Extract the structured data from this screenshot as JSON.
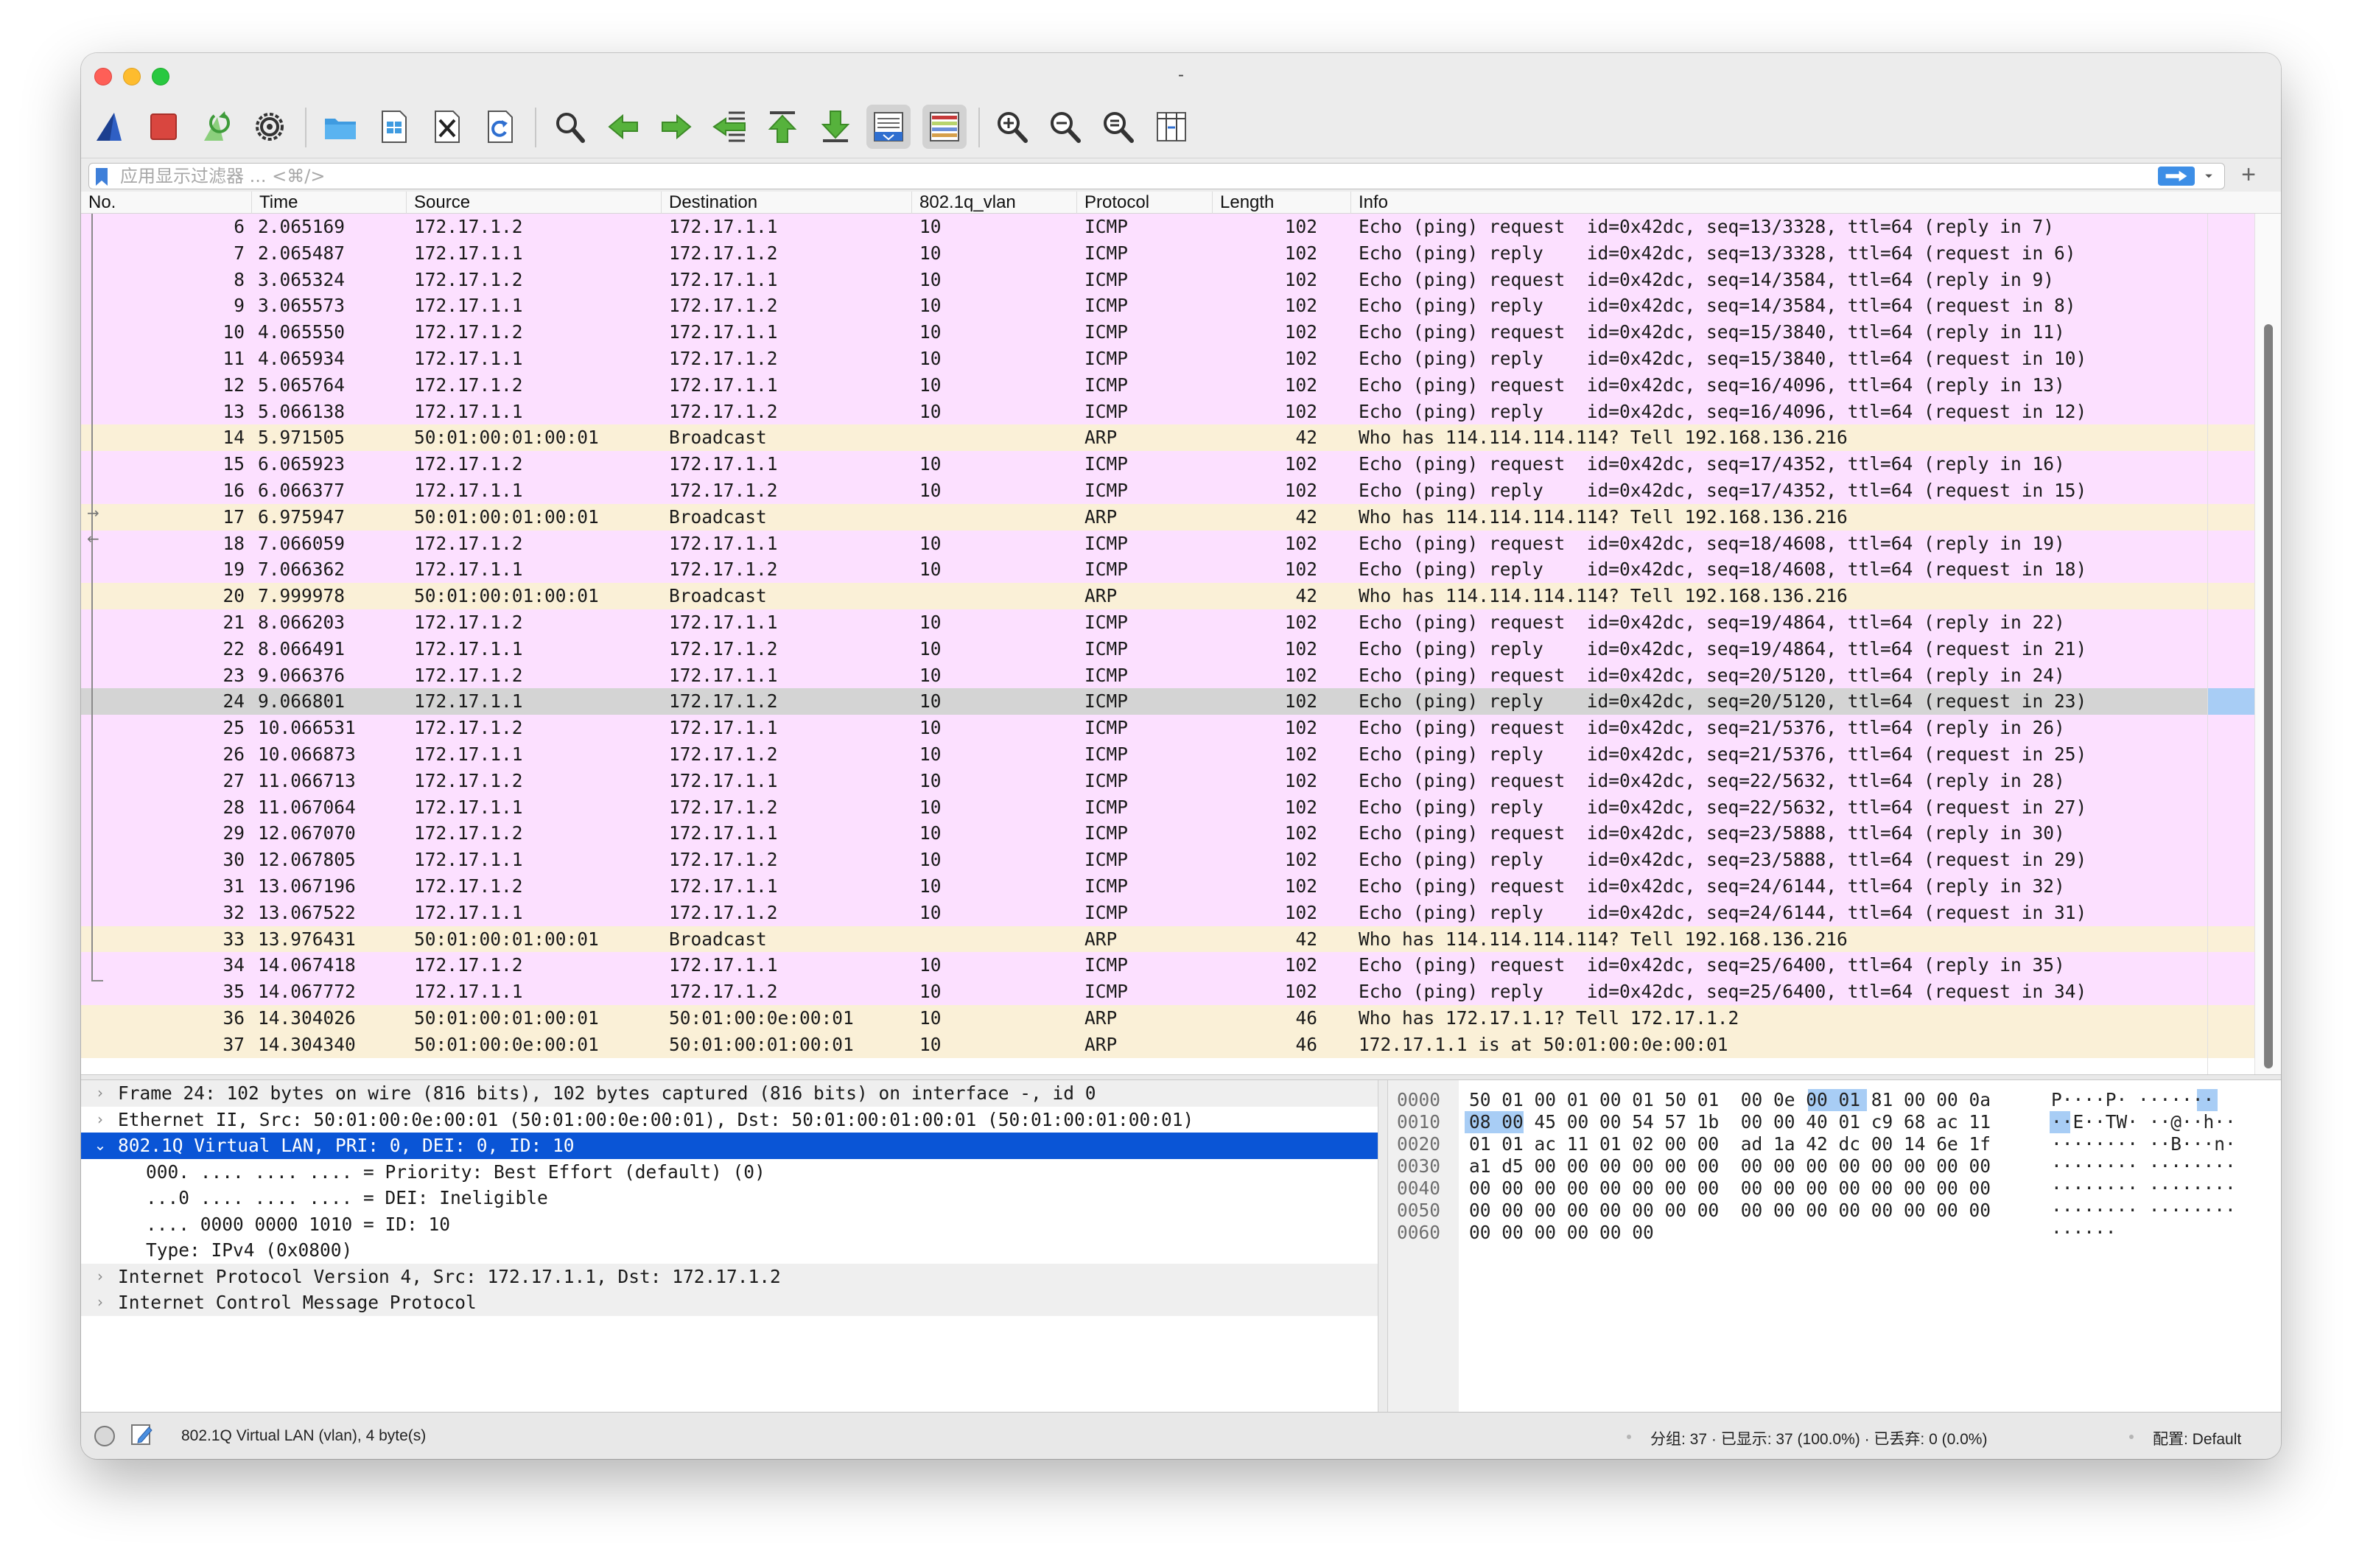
{
  "window": {
    "title": "-"
  },
  "filter": {
    "placeholder": "应用显示过滤器 ... <⌘/>"
  },
  "columns": {
    "no": "No.",
    "time": "Time",
    "source": "Source",
    "destination": "Destination",
    "vlan": "802.1q_vlan",
    "protocol": "Protocol",
    "length": "Length",
    "info": "Info"
  },
  "toolbar": {
    "buttons": [
      "shark-fin-start-icon",
      "stop-capture-icon",
      "restart-capture-icon",
      "capture-options-icon",
      "open-file-icon",
      "save-file-icon",
      "close-file-icon",
      "reload-file-icon",
      "find-packet-icon",
      "go-back-icon",
      "go-forward-icon",
      "go-to-packet-icon",
      "go-first-icon",
      "go-last-icon",
      "autoscroll-icon",
      "colorize-icon",
      "zoom-in-icon",
      "zoom-out-icon",
      "zoom-reset-icon",
      "resize-columns-icon"
    ]
  },
  "packets": [
    {
      "no": "6",
      "time": "2.065169",
      "src": "172.17.1.2",
      "dst": "172.17.1.1",
      "vlan": "10",
      "proto": "ICMP",
      "len": "102",
      "info": "Echo (ping) request  id=0x42dc, seq=13/3328, ttl=64 (reply in 7)"
    },
    {
      "no": "7",
      "time": "2.065487",
      "src": "172.17.1.1",
      "dst": "172.17.1.2",
      "vlan": "10",
      "proto": "ICMP",
      "len": "102",
      "info": "Echo (ping) reply    id=0x42dc, seq=13/3328, ttl=64 (request in 6)"
    },
    {
      "no": "8",
      "time": "3.065324",
      "src": "172.17.1.2",
      "dst": "172.17.1.1",
      "vlan": "10",
      "proto": "ICMP",
      "len": "102",
      "info": "Echo (ping) request  id=0x42dc, seq=14/3584, ttl=64 (reply in 9)"
    },
    {
      "no": "9",
      "time": "3.065573",
      "src": "172.17.1.1",
      "dst": "172.17.1.2",
      "vlan": "10",
      "proto": "ICMP",
      "len": "102",
      "info": "Echo (ping) reply    id=0x42dc, seq=14/3584, ttl=64 (request in 8)"
    },
    {
      "no": "10",
      "time": "4.065550",
      "src": "172.17.1.2",
      "dst": "172.17.1.1",
      "vlan": "10",
      "proto": "ICMP",
      "len": "102",
      "info": "Echo (ping) request  id=0x42dc, seq=15/3840, ttl=64 (reply in 11)"
    },
    {
      "no": "11",
      "time": "4.065934",
      "src": "172.17.1.1",
      "dst": "172.17.1.2",
      "vlan": "10",
      "proto": "ICMP",
      "len": "102",
      "info": "Echo (ping) reply    id=0x42dc, seq=15/3840, ttl=64 (request in 10)"
    },
    {
      "no": "12",
      "time": "5.065764",
      "src": "172.17.1.2",
      "dst": "172.17.1.1",
      "vlan": "10",
      "proto": "ICMP",
      "len": "102",
      "info": "Echo (ping) request  id=0x42dc, seq=16/4096, ttl=64 (reply in 13)"
    },
    {
      "no": "13",
      "time": "5.066138",
      "src": "172.17.1.1",
      "dst": "172.17.1.2",
      "vlan": "10",
      "proto": "ICMP",
      "len": "102",
      "info": "Echo (ping) reply    id=0x42dc, seq=16/4096, ttl=64 (request in 12)"
    },
    {
      "no": "14",
      "time": "5.971505",
      "src": "50:01:00:01:00:01",
      "dst": "Broadcast",
      "vlan": "",
      "proto": "ARP",
      "len": "42",
      "info": "Who has 114.114.114.114? Tell 192.168.136.216"
    },
    {
      "no": "15",
      "time": "6.065923",
      "src": "172.17.1.2",
      "dst": "172.17.1.1",
      "vlan": "10",
      "proto": "ICMP",
      "len": "102",
      "info": "Echo (ping) request  id=0x42dc, seq=17/4352, ttl=64 (reply in 16)"
    },
    {
      "no": "16",
      "time": "6.066377",
      "src": "172.17.1.1",
      "dst": "172.17.1.2",
      "vlan": "10",
      "proto": "ICMP",
      "len": "102",
      "info": "Echo (ping) reply    id=0x42dc, seq=17/4352, ttl=64 (request in 15)"
    },
    {
      "no": "17",
      "time": "6.975947",
      "src": "50:01:00:01:00:01",
      "dst": "Broadcast",
      "vlan": "",
      "proto": "ARP",
      "len": "42",
      "info": "Who has 114.114.114.114? Tell 192.168.136.216"
    },
    {
      "no": "18",
      "time": "7.066059",
      "src": "172.17.1.2",
      "dst": "172.17.1.1",
      "vlan": "10",
      "proto": "ICMP",
      "len": "102",
      "info": "Echo (ping) request  id=0x42dc, seq=18/4608, ttl=64 (reply in 19)"
    },
    {
      "no": "19",
      "time": "7.066362",
      "src": "172.17.1.1",
      "dst": "172.17.1.2",
      "vlan": "10",
      "proto": "ICMP",
      "len": "102",
      "info": "Echo (ping) reply    id=0x42dc, seq=18/4608, ttl=64 (request in 18)"
    },
    {
      "no": "20",
      "time": "7.999978",
      "src": "50:01:00:01:00:01",
      "dst": "Broadcast",
      "vlan": "",
      "proto": "ARP",
      "len": "42",
      "info": "Who has 114.114.114.114? Tell 192.168.136.216"
    },
    {
      "no": "21",
      "time": "8.066203",
      "src": "172.17.1.2",
      "dst": "172.17.1.1",
      "vlan": "10",
      "proto": "ICMP",
      "len": "102",
      "info": "Echo (ping) request  id=0x42dc, seq=19/4864, ttl=64 (reply in 22)"
    },
    {
      "no": "22",
      "time": "8.066491",
      "src": "172.17.1.1",
      "dst": "172.17.1.2",
      "vlan": "10",
      "proto": "ICMP",
      "len": "102",
      "info": "Echo (ping) reply    id=0x42dc, seq=19/4864, ttl=64 (request in 21)"
    },
    {
      "no": "23",
      "time": "9.066376",
      "src": "172.17.1.2",
      "dst": "172.17.1.1",
      "vlan": "10",
      "proto": "ICMP",
      "len": "102",
      "info": "Echo (ping) request  id=0x42dc, seq=20/5120, ttl=64 (reply in 24)"
    },
    {
      "no": "24",
      "time": "9.066801",
      "src": "172.17.1.1",
      "dst": "172.17.1.2",
      "vlan": "10",
      "proto": "ICMP",
      "len": "102",
      "info": "Echo (ping) reply    id=0x42dc, seq=20/5120, ttl=64 (request in 23)",
      "selected": true
    },
    {
      "no": "25",
      "time": "10.066531",
      "src": "172.17.1.2",
      "dst": "172.17.1.1",
      "vlan": "10",
      "proto": "ICMP",
      "len": "102",
      "info": "Echo (ping) request  id=0x42dc, seq=21/5376, ttl=64 (reply in 26)"
    },
    {
      "no": "26",
      "time": "10.066873",
      "src": "172.17.1.1",
      "dst": "172.17.1.2",
      "vlan": "10",
      "proto": "ICMP",
      "len": "102",
      "info": "Echo (ping) reply    id=0x42dc, seq=21/5376, ttl=64 (request in 25)"
    },
    {
      "no": "27",
      "time": "11.066713",
      "src": "172.17.1.2",
      "dst": "172.17.1.1",
      "vlan": "10",
      "proto": "ICMP",
      "len": "102",
      "info": "Echo (ping) request  id=0x42dc, seq=22/5632, ttl=64 (reply in 28)"
    },
    {
      "no": "28",
      "time": "11.067064",
      "src": "172.17.1.1",
      "dst": "172.17.1.2",
      "vlan": "10",
      "proto": "ICMP",
      "len": "102",
      "info": "Echo (ping) reply    id=0x42dc, seq=22/5632, ttl=64 (request in 27)"
    },
    {
      "no": "29",
      "time": "12.067070",
      "src": "172.17.1.2",
      "dst": "172.17.1.1",
      "vlan": "10",
      "proto": "ICMP",
      "len": "102",
      "info": "Echo (ping) request  id=0x42dc, seq=23/5888, ttl=64 (reply in 30)"
    },
    {
      "no": "30",
      "time": "12.067805",
      "src": "172.17.1.1",
      "dst": "172.17.1.2",
      "vlan": "10",
      "proto": "ICMP",
      "len": "102",
      "info": "Echo (ping) reply    id=0x42dc, seq=23/5888, ttl=64 (request in 29)"
    },
    {
      "no": "31",
      "time": "13.067196",
      "src": "172.17.1.2",
      "dst": "172.17.1.1",
      "vlan": "10",
      "proto": "ICMP",
      "len": "102",
      "info": "Echo (ping) request  id=0x42dc, seq=24/6144, ttl=64 (reply in 32)"
    },
    {
      "no": "32",
      "time": "13.067522",
      "src": "172.17.1.1",
      "dst": "172.17.1.2",
      "vlan": "10",
      "proto": "ICMP",
      "len": "102",
      "info": "Echo (ping) reply    id=0x42dc, seq=24/6144, ttl=64 (request in 31)"
    },
    {
      "no": "33",
      "time": "13.976431",
      "src": "50:01:00:01:00:01",
      "dst": "Broadcast",
      "vlan": "",
      "proto": "ARP",
      "len": "42",
      "info": "Who has 114.114.114.114? Tell 192.168.136.216"
    },
    {
      "no": "34",
      "time": "14.067418",
      "src": "172.17.1.2",
      "dst": "172.17.1.1",
      "vlan": "10",
      "proto": "ICMP",
      "len": "102",
      "info": "Echo (ping) request  id=0x42dc, seq=25/6400, ttl=64 (reply in 35)"
    },
    {
      "no": "35",
      "time": "14.067772",
      "src": "172.17.1.1",
      "dst": "172.17.1.2",
      "vlan": "10",
      "proto": "ICMP",
      "len": "102",
      "info": "Echo (ping) reply    id=0x42dc, seq=25/6400, ttl=64 (request in 34)"
    },
    {
      "no": "36",
      "time": "14.304026",
      "src": "50:01:00:01:00:01",
      "dst": "50:01:00:0e:00:01",
      "vlan": "10",
      "proto": "ARP",
      "len": "46",
      "info": "Who has 172.17.1.1? Tell 172.17.1.2"
    },
    {
      "no": "37",
      "time": "14.304340",
      "src": "50:01:00:0e:00:01",
      "dst": "50:01:00:01:00:01",
      "vlan": "10",
      "proto": "ARP",
      "len": "46",
      "info": "172.17.1.1 is at 50:01:00:0e:00:01"
    }
  ],
  "details": [
    {
      "text": "Frame 24: 102 bytes on wire (816 bits), 102 bytes captured (816 bits) on interface -, id 0",
      "disclosure": "›",
      "level": 0,
      "striped": true
    },
    {
      "text": "Ethernet II, Src: 50:01:00:0e:00:01 (50:01:00:0e:00:01), Dst: 50:01:00:01:00:01 (50:01:00:01:00:01)",
      "disclosure": "›",
      "level": 0
    },
    {
      "text": "802.1Q Virtual LAN, PRI: 0, DEI: 0, ID: 10",
      "disclosure": "⌄",
      "level": 0,
      "selected": true
    },
    {
      "text": "000. .... .... .... = Priority: Best Effort (default) (0)",
      "disclosure": "",
      "level": 1
    },
    {
      "text": "...0 .... .... .... = DEI: Ineligible",
      "disclosure": "",
      "level": 1
    },
    {
      "text": ".... 0000 0000 1010 = ID: 10",
      "disclosure": "",
      "level": 1
    },
    {
      "text": "Type: IPv4 (0x0800)",
      "disclosure": "",
      "level": 1
    },
    {
      "text": "Internet Protocol Version 4, Src: 172.17.1.1, Dst: 172.17.1.2",
      "disclosure": "›",
      "level": 0,
      "striped": true
    },
    {
      "text": "Internet Control Message Protocol",
      "disclosure": "›",
      "level": 0,
      "striped": true
    }
  ],
  "bytes": [
    {
      "offset": "0000",
      "hex": "50 01 00 01 00 01 50 01  00 0e 00 01 81 00 00 0a",
      "ascii": "P····P· ·······"
    },
    {
      "offset": "0010",
      "hex": "08 00 45 00 00 54 57 1b  00 00 40 01 c9 68 ac 11",
      "ascii": "··E··TW· ··@··h··"
    },
    {
      "offset": "0020",
      "hex": "01 01 ac 11 01 02 00 00  ad 1a 42 dc 00 14 6e 1f",
      "ascii": "········ ··B···n·"
    },
    {
      "offset": "0030",
      "hex": "a1 d5 00 00 00 00 00 00  00 00 00 00 00 00 00 00",
      "ascii": "········ ········"
    },
    {
      "offset": "0040",
      "hex": "00 00 00 00 00 00 00 00  00 00 00 00 00 00 00 00",
      "ascii": "········ ········"
    },
    {
      "offset": "0050",
      "hex": "00 00 00 00 00 00 00 00  00 00 00 00 00 00 00 00",
      "ascii": "········ ········"
    },
    {
      "offset": "0060",
      "hex": "00 00 00 00 00 00",
      "ascii": "······"
    }
  ],
  "status": {
    "field": "802.1Q Virtual LAN (vlan), 4 byte(s)",
    "stats": "分组: 37 · 已显示: 37 (100.0%) · 已丢弃: 0 (0.0%)",
    "profile": "配置: Default"
  },
  "colors": {
    "icmp_row": "#fce0ff",
    "arp_row": "#faf0d7",
    "selected_row": "#d4d4d4",
    "selected_detail": "#0a55d6",
    "byte_highlight": "#a8cdf5"
  }
}
